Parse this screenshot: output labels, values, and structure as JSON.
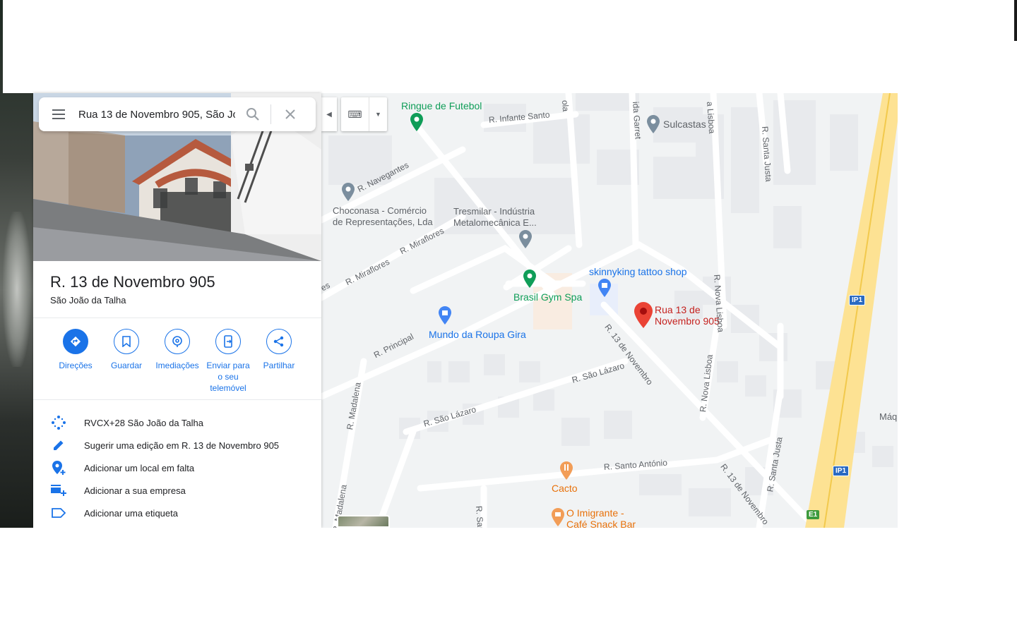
{
  "search": {
    "query": "Rua 13 de Novembro 905, São Jo"
  },
  "place": {
    "title": "R. 13 de Novembro 905",
    "subtitle": "São João da Talha"
  },
  "actions": [
    {
      "label": "Direções",
      "icon": "directions-icon"
    },
    {
      "label": "Guardar",
      "icon": "bookmark-icon"
    },
    {
      "label": "Imediações",
      "icon": "nearby-icon"
    },
    {
      "label": "Enviar para o seu telemóvel",
      "icon": "send-to-phone-icon"
    },
    {
      "label": "Partilhar",
      "icon": "share-icon"
    }
  ],
  "info_rows": [
    {
      "text": "RVCX+28 São João da Talha",
      "icon": "plus-code-icon"
    },
    {
      "text": "Sugerir uma edição em R. 13 de Novembro 905",
      "icon": "pencil-icon"
    },
    {
      "text": "Adicionar um local em falta",
      "icon": "add-place-icon"
    },
    {
      "text": "Adicionar a sua empresa",
      "icon": "add-business-icon"
    },
    {
      "text": "Adicionar uma etiqueta",
      "icon": "label-icon"
    }
  ],
  "map": {
    "pois": {
      "ringue": "Ringue de Futebol",
      "sulcastas": "Sulcastas",
      "choconasa_1": "Choconasa - Comércio",
      "choconasa_2": "de Representações, Lda",
      "tresmilar_1": "Tresmilar - Indústria",
      "tresmilar_2": "Metalomecânica E...",
      "skinnyking": "skinnyking tattoo shop",
      "brasil_gym": "Brasil Gym Spa",
      "mundo_roupa": "Mundo da Roupa Gira",
      "pin_1": "Rua 13 de",
      "pin_2": "Novembro 905",
      "cacto": "Cacto",
      "imigrante_1": "O Imigrante -",
      "imigrante_2": "Café Snack Bar",
      "maquina": "Máqui"
    },
    "roads": {
      "infante_santo": "R. Infante Santo",
      "navegantes": "R. Navegantes",
      "miraflores_a": "R. Miraflores",
      "miraflores_b": "R. Miraflores",
      "principal": "R. Principal",
      "madalena_a": "R. Madalena",
      "madalena_b": "R. Madalena",
      "sao_lazaro_a": "R. São Lázaro",
      "sao_lazaro_b": "R. São Lázaro",
      "santo_antonio": "R. Santo António",
      "treze_novembro_a": "R. 13 de Novembro",
      "treze_novembro_b": "R. 13 de Novembro",
      "nova_lisboa_a": "R. Nova Lisboa",
      "nova_lisboa_b": "R. Nova Lisboa",
      "santa_justa_a": "R. Santa Justa",
      "santa_justa_b": "R. Santa Justa",
      "garret": "ida Garret",
      "lisboa": "a Lisboa",
      "ola": "ola",
      "es": "es",
      "sant": "R. Sant"
    },
    "badges": {
      "ip1_a": "IP1",
      "ip1_b": "IP1",
      "e1": "E1"
    },
    "colors": {
      "pin": "#ea4335",
      "highway": "#fde293",
      "accent": "#1a73e8",
      "poi_green": "#0f9d58"
    }
  }
}
